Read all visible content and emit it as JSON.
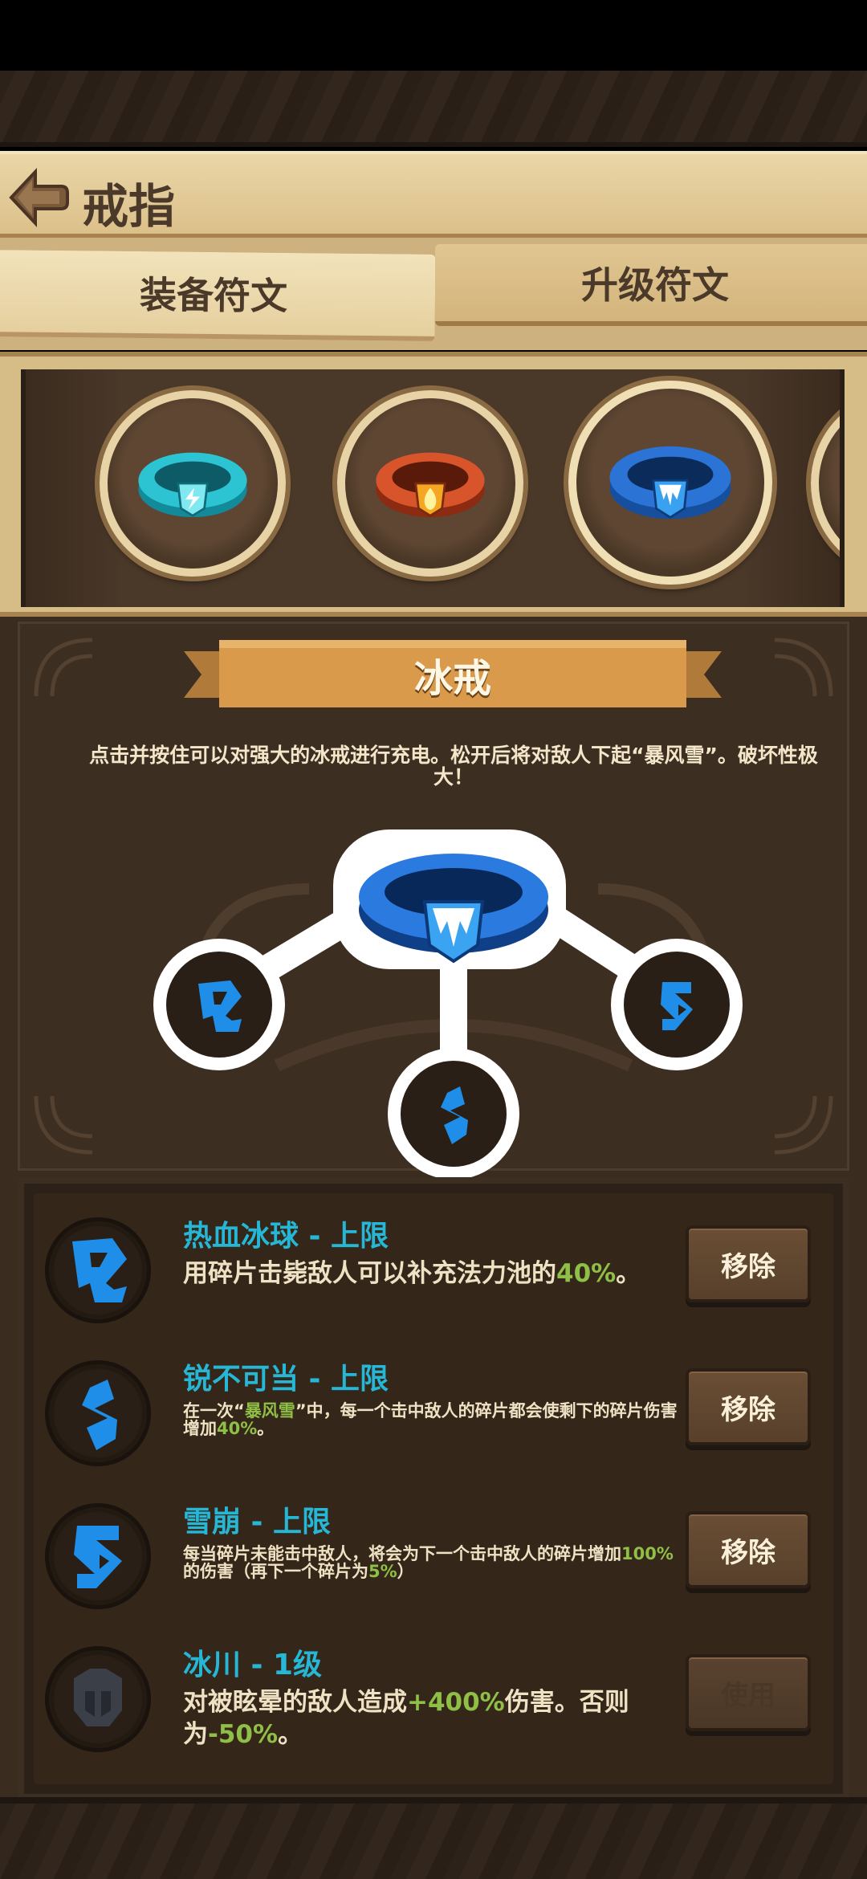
{
  "header": {
    "title": "戒指"
  },
  "tabs": [
    {
      "label": "装备符文",
      "active": false
    },
    {
      "label": "升级符文",
      "active": true
    }
  ],
  "carousel": {
    "rings": [
      {
        "name": "lightning-ring-icon",
        "color": "#2cc3d3"
      },
      {
        "name": "fire-ring-icon",
        "color": "#d8542a"
      },
      {
        "name": "ice-ring-icon",
        "color": "#2b74d6",
        "selected": true
      },
      {
        "name": "green-ring-icon",
        "color": "#3b8a3a"
      }
    ]
  },
  "selected_ring": {
    "name": "冰戒",
    "description": "点击并按住可以对强大的冰戒进行充电。松开后将对敌人下起“暴风雪”。破坏性极大！"
  },
  "runes": [
    {
      "title": "热血冰球 - 上限",
      "desc_parts": [
        "用碎片击毙敌人可以补充法力池的",
        "40%",
        "。"
      ],
      "button": "移除",
      "icon": "rune-hook-icon",
      "size": "big"
    },
    {
      "title": "锐不可当 - 上限",
      "desc_parts": [
        "在一次“",
        "暴风雪",
        "”中，每一个击中敌人的碎片都会使剩下的碎片伤害增加",
        "40%",
        "。"
      ],
      "button": "移除",
      "icon": "rune-s-icon",
      "size": "small"
    },
    {
      "title": "雪崩 - 上限",
      "desc_parts": [
        "每当碎片未能击中敌人，将会为下一个击中敌人的碎片增加",
        "100%",
        "的伤害（再下一个碎片为",
        "5%",
        "）"
      ],
      "button": "移除",
      "icon": "rune-z-icon",
      "size": "small"
    },
    {
      "title": "冰川 - 1级",
      "desc_parts": [
        "对被眩晕的敌人造成",
        "+400%",
        "伤害。否则为",
        "-50%",
        "。"
      ],
      "button": "使用",
      "icon": "rune-helmet-icon",
      "size": "big",
      "locked": true
    }
  ],
  "colors": {
    "accent_title": "#27b7d6",
    "highlight": "#8fbf46",
    "ice_blue": "#1f8ee8"
  }
}
